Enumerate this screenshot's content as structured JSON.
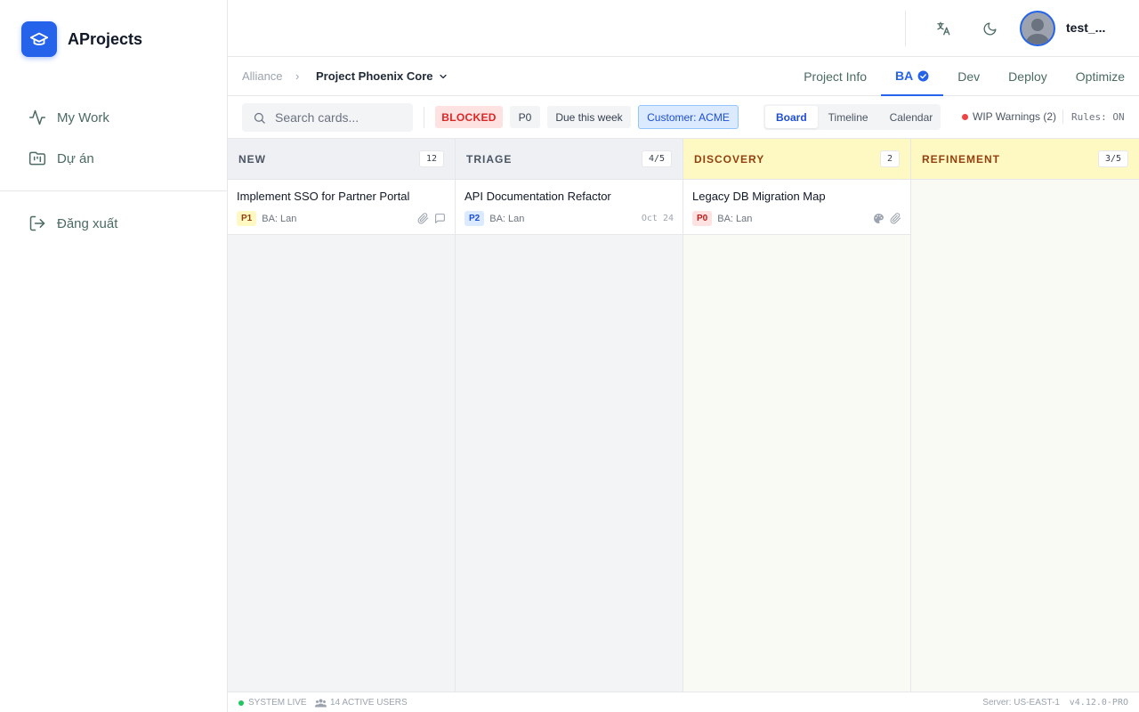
{
  "brand": {
    "name": "AProjects",
    "logo_icon": "graduation-cap-icon",
    "accent": "#2563eb"
  },
  "sidebar": {
    "items": [
      {
        "label": "My Work",
        "icon": "activity-icon"
      },
      {
        "label": "Dự án",
        "icon": "folder-kanban-icon"
      }
    ],
    "secondary": [
      {
        "label": "Đăng xuất",
        "icon": "logout-icon"
      }
    ]
  },
  "header": {
    "user": {
      "name": "test_..."
    },
    "icons": [
      "translate-icon",
      "moon-icon"
    ]
  },
  "breadcrumb": {
    "root": "Alliance",
    "separator": "›",
    "project": "Project Phoenix Core"
  },
  "tabs": [
    {
      "label": "Project Info",
      "active": false
    },
    {
      "label": "BA",
      "active": true
    },
    {
      "label": "Dev",
      "active": false
    },
    {
      "label": "Deploy",
      "active": false
    },
    {
      "label": "Optimize",
      "active": false
    }
  ],
  "filters": {
    "search_placeholder": "Search cards...",
    "chips": {
      "blocked": "BLOCKED",
      "p0": "P0",
      "due": "Due this week",
      "customer": "Customer: ACME"
    },
    "views": [
      {
        "label": "Board",
        "active": true
      },
      {
        "label": "Timeline",
        "active": false
      },
      {
        "label": "Calendar",
        "active": false
      }
    ],
    "wip_warnings": "WIP Warnings (2)",
    "rules": "Rules: ON"
  },
  "columns": [
    {
      "title": "NEW",
      "count": "12",
      "cards": [
        {
          "title": "Implement SSO for Partner Portal",
          "priority": "P1",
          "assignee": "BA: Lan",
          "icons": [
            "paperclip-icon",
            "comment-icon"
          ]
        }
      ]
    },
    {
      "title": "TRIAGE",
      "count": "4/5",
      "cards": [
        {
          "title": "API Documentation Refactor",
          "priority": "P2",
          "assignee": "BA: Lan",
          "due": "Oct 24"
        }
      ]
    },
    {
      "title": "DISCOVERY",
      "count": "2",
      "cards": [
        {
          "title": "Legacy DB Migration Map",
          "priority": "P0",
          "assignee": "BA: Lan",
          "icons": [
            "palette-icon",
            "paperclip-icon"
          ]
        }
      ]
    },
    {
      "title": "REFINEMENT",
      "count": "3/5",
      "cards": []
    }
  ],
  "footer": {
    "status": "SYSTEM LIVE",
    "active_users": "14 ACTIVE USERS",
    "server": "Server: US-EAST-1",
    "version": "v4.12.0-PRO"
  }
}
